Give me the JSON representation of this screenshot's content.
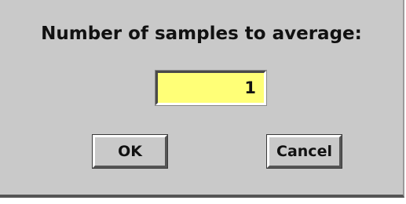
{
  "dialog": {
    "prompt": "Number of samples to average:",
    "field_value": "1",
    "ok_label": "OK",
    "cancel_label": "Cancel"
  },
  "colors": {
    "dialog_background": "#c9c9c9",
    "field_background": "#ffff77"
  }
}
